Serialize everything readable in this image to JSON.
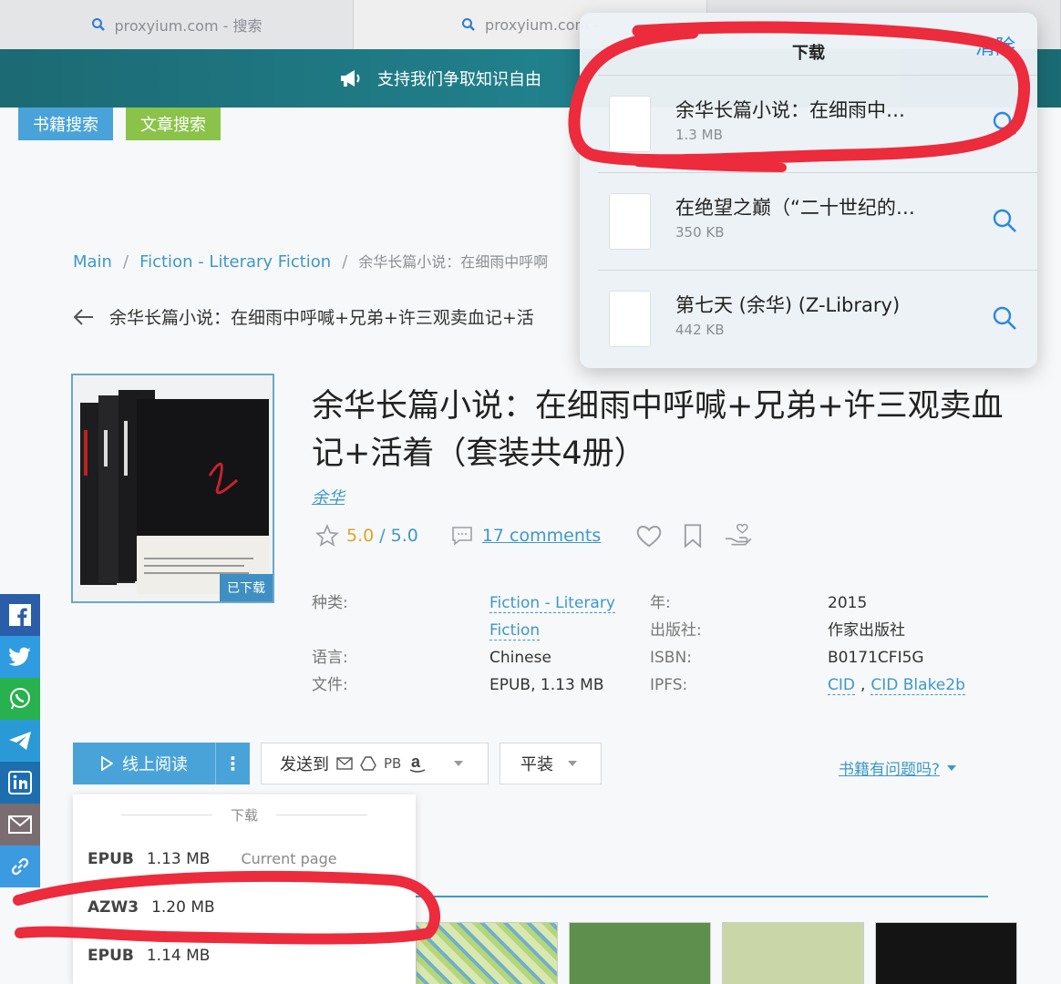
{
  "browser": {
    "tabs": [
      {
        "label": "proxyium.com - 搜索"
      },
      {
        "label": "proxyium.com -"
      }
    ]
  },
  "banner": {
    "text": "支持我们争取知识自由"
  },
  "search_tabs": {
    "books": "书籍搜索",
    "articles": "文章搜索"
  },
  "breadcrumb": {
    "main": "Main",
    "sep": "/",
    "category": "Fiction - Literary Fiction",
    "current": "余华长篇小说：在细雨中呼啊"
  },
  "back_title": "余华长篇小说：在细雨中呼喊+兄弟+许三观卖血记+活",
  "book": {
    "title": "余华长篇小说：在细雨中呼喊+兄弟+许三观卖血记+活着（套装共4册）",
    "author": "余华",
    "cover_badge": "已下载",
    "rating": "5.0",
    "rating_sep": "/",
    "rating_max": "5.0",
    "comments": "17 comments"
  },
  "meta": {
    "category_label": "种类:",
    "category_value_1": "Fiction - Literary",
    "category_value_2": "Fiction",
    "language_label": "语言:",
    "language_value": "Chinese",
    "file_label": "文件:",
    "file_value": "EPUB, 1.13 MB",
    "year_label": "年:",
    "year_value": "2015",
    "publisher_label": "出版社:",
    "publisher_value": "作家出版社",
    "isbn_label": "ISBN:",
    "isbn_value": "B0171CFI5G",
    "ipfs_label": "IPFS:",
    "ipfs_cid": "CID",
    "ipfs_comma": ",",
    "ipfs_blake": "CID Blake2b"
  },
  "actions": {
    "read_online": "线上阅读",
    "more": "⋮",
    "send_to": "发送到",
    "send_pb": "PB",
    "format": "平装",
    "problem": "书籍有问题吗?"
  },
  "download_menu": {
    "header": "下载",
    "items": [
      {
        "format": "EPUB",
        "size": "1.13 MB",
        "note": "Current page"
      },
      {
        "format": "AZW3",
        "size": "1.20 MB",
        "note": ""
      },
      {
        "format": "EPUB",
        "size": "1.14 MB",
        "note": ""
      }
    ]
  },
  "downloads_popover": {
    "title": "下载",
    "clear": "清除",
    "items": [
      {
        "name": "余华长篇小说：在细雨中…",
        "size": "1.3 MB"
      },
      {
        "name": "在绝望之巅（“二十世纪的…",
        "size": "350 KB"
      },
      {
        "name": "第七天 (余华) (Z-Library)",
        "size": "442 KB"
      }
    ]
  },
  "colors": {
    "accent": "#3e98c9",
    "banner": "#20808b",
    "article_tab": "#8bc34a",
    "annotation": "#ec2b3c"
  },
  "share_icons": [
    "facebook-icon",
    "twitter-icon",
    "whatsapp-icon",
    "telegram-icon",
    "linkedin-icon",
    "email-icon",
    "link-icon"
  ]
}
